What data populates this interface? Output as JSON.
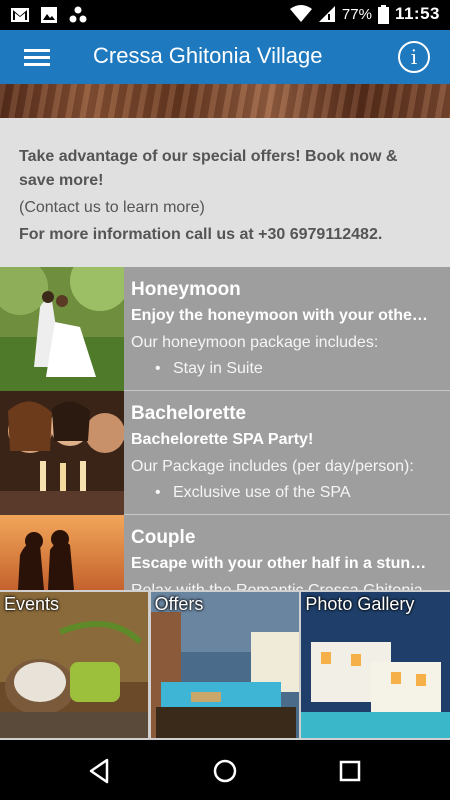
{
  "status_bar": {
    "icons": [
      "gmail-icon",
      "image-icon",
      "apps-icon",
      "wifi-icon",
      "signal-icon",
      "battery-icon"
    ],
    "battery": "77%",
    "time": "11:53"
  },
  "app_bar": {
    "title": "Cressa Ghitonia Village",
    "menu_icon": "hamburger-menu-icon",
    "info_icon": "info-icon",
    "color": "#1e79bf"
  },
  "info": {
    "headline": "Take advantage of our special offers! Book now & save more!",
    "contact": "(Contact us to learn more)",
    "phone_line": "For more information call us at +30 6979112482."
  },
  "offers": [
    {
      "title": "Honeymoon",
      "subtitle": "Enjoy the honeymoon with your other half!",
      "description": "Our honeymoon package includes:",
      "bullet": "Stay in Suite"
    },
    {
      "title": "Bachelorette",
      "subtitle": "Bachelorette SPA Party!",
      "description": "Our Package includes (per day/person):",
      "bullet": "Exclusive use of the SPA"
    },
    {
      "title": "Couple",
      "subtitle": "Escape with your other half in a stunning place",
      "description": "Relax with the Romantic Cressa Ghitonia",
      "bullet": ""
    }
  ],
  "tiles": [
    {
      "label": "Events"
    },
    {
      "label": "Offers"
    },
    {
      "label": "Photo Gallery"
    }
  ],
  "nav": {
    "back": "back-icon",
    "home": "home-icon",
    "recents": "recents-icon"
  }
}
